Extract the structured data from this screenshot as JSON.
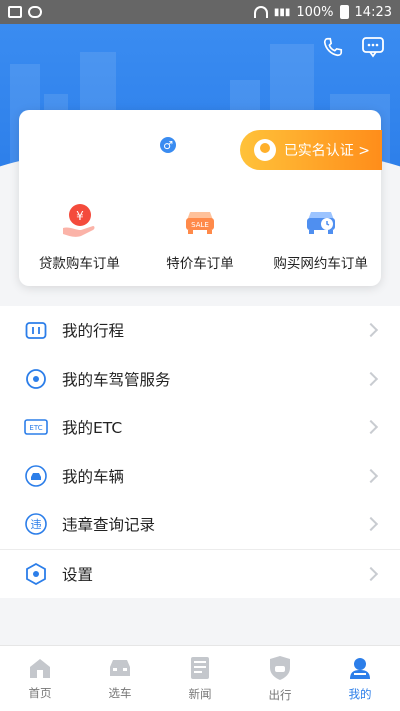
{
  "status_bar": {
    "battery": "100%",
    "time": "14:23"
  },
  "profile": {
    "gender_symbol": "♂",
    "verify_label": "已实名认证 >"
  },
  "shortcuts": [
    {
      "label": "贷款购车订单",
      "icon": "loan-yuan-icon"
    },
    {
      "label": "特价车订单",
      "icon": "sale-car-icon"
    },
    {
      "label": "购买网约车订单",
      "icon": "ride-hailing-car-icon"
    }
  ],
  "menu": [
    {
      "label": "我的行程",
      "icon": "suitcase-icon"
    },
    {
      "label": "我的车驾管服务",
      "icon": "disc-icon"
    },
    {
      "label": "我的ETC",
      "icon": "etc-icon"
    },
    {
      "label": "我的车辆",
      "icon": "car-icon"
    },
    {
      "label": "违章查询记录",
      "icon": "violation-icon"
    },
    {
      "label": "设置",
      "icon": "settings-hex-icon"
    }
  ],
  "bottom_nav": [
    {
      "label": "首页",
      "active": false
    },
    {
      "label": "选车",
      "active": false
    },
    {
      "label": "新闻",
      "active": false
    },
    {
      "label": "出行",
      "active": false
    },
    {
      "label": "我的",
      "active": true
    }
  ],
  "colors": {
    "primary": "#2c7ee9",
    "accent_orange": "#ff8d1a",
    "bg": "#f4f5f7"
  }
}
